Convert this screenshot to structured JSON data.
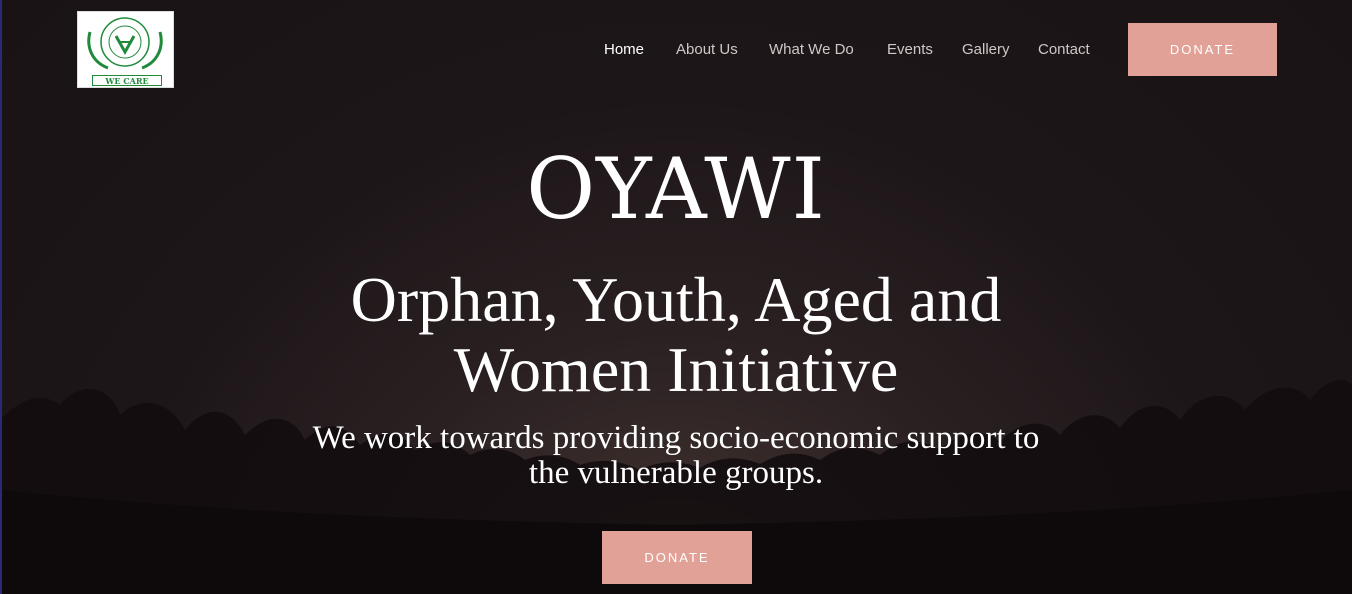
{
  "brand": {
    "logo_icon": "hands-logo-icon",
    "logo_caption": "WE CARE",
    "logo_ring_text": "ORPHANS • YOUTH • THE AGED AND WOMEN INITIATIVE"
  },
  "nav": {
    "items": [
      {
        "label": "Home",
        "active": true
      },
      {
        "label": "About Us"
      },
      {
        "label": "What We Do"
      },
      {
        "label": "Events"
      },
      {
        "label": "Gallery"
      },
      {
        "label": "Contact"
      }
    ],
    "donate_label": "DONATE"
  },
  "hero": {
    "title": "OYAWI",
    "subtitle_line1": "Orphan, Youth, Aged and",
    "subtitle_line2": "Women Initiative",
    "tagline_line1": "We work towards providing socio-economic support to",
    "tagline_line2": "the vulnerable groups.",
    "donate_label": "DONATE"
  },
  "colors": {
    "accent": "#e2a196",
    "logo_green": "#1f8a3b",
    "background": "#1c1517"
  }
}
